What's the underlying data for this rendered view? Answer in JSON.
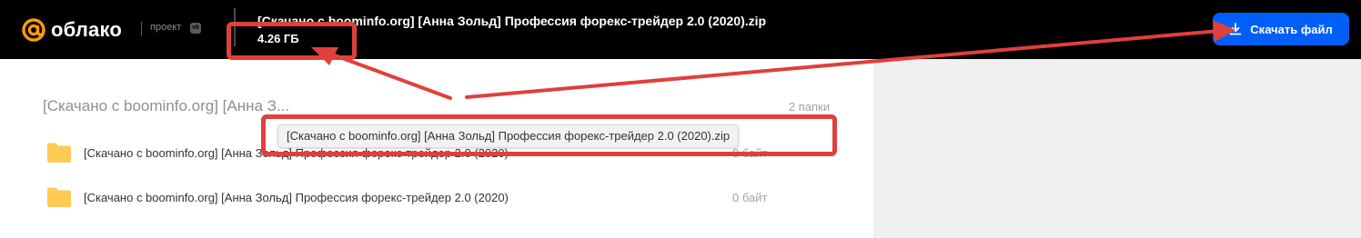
{
  "header": {
    "logo_text": "облако",
    "logo_project": "проект",
    "logo_badge": "vk",
    "file_name": "[Скачано с boominfo.org] [Анна Зольд] Профессия форекс-трейдер 2.0 (2020).zip",
    "file_size": "4.26 ГБ",
    "download_label": "Скачать файл",
    "download_icon": "download-icon",
    "accent_color": "#005ff9",
    "logo_color": "#ff9e00"
  },
  "main": {
    "folder_title": "[Скачано с boominfo.org] [Анна З...",
    "folder_count": "2 папки",
    "tooltip": "[Скачано с boominfo.org] [Анна Зольд] Профессия форекс-трейдер 2.0 (2020).zip",
    "items": [
      {
        "name": "[Скачано с boominfo.org] [Анна Зольд] Профессия форекс-трейдер 2.0 (2020)",
        "size": "0 байт",
        "icon": "folder-icon"
      },
      {
        "name": "[Скачано с boominfo.org] [Анна Зольд] Профессия форекс-трейдер 2.0 (2020)",
        "size": "0 байт",
        "icon": "folder-icon"
      }
    ]
  },
  "annotation": {
    "color": "#e0403a"
  }
}
